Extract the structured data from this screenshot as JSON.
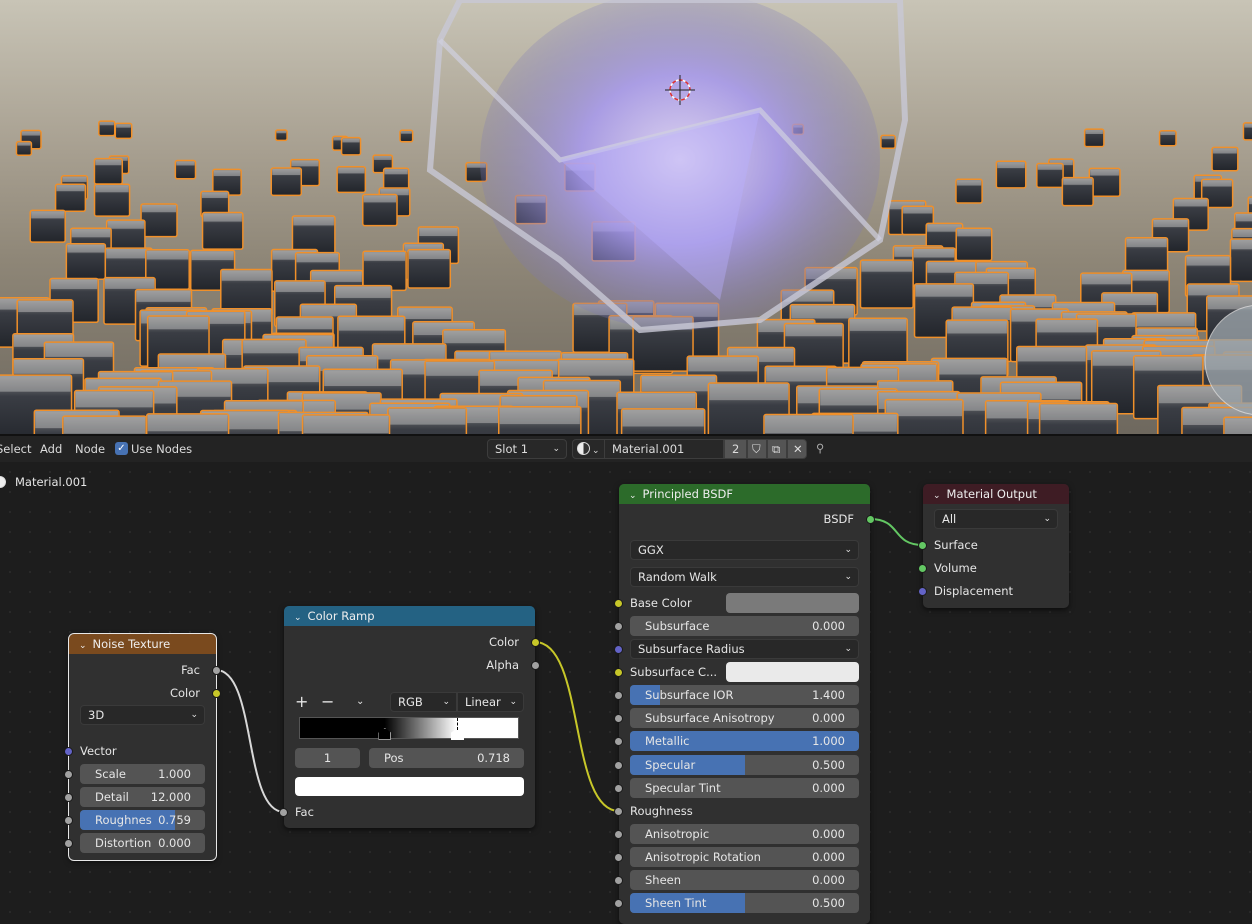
{
  "header": {
    "menus": [
      "Select",
      "Add",
      "Node"
    ],
    "use_nodes": {
      "label": "Use Nodes",
      "checked": true
    },
    "slot": "Slot 1",
    "material_name": "Material.001",
    "user_count": "2",
    "icons": [
      "material-ball-icon",
      "fake-user-shield-icon",
      "duplicate-icon",
      "close-icon",
      "pin-icon"
    ]
  },
  "breadcrumb": "Material.001",
  "colors": {
    "accent": "#4772b3",
    "selection_outline": "#f0902a",
    "socket_float": "#a1a1a1",
    "socket_color": "#c7c729",
    "socket_vector": "#6363c7",
    "socket_shader": "#63c763"
  },
  "nodes": {
    "principled": {
      "title": "Principled BSDF",
      "header_color": "#2c6b2a",
      "rows": [
        {
          "type": "output",
          "label": "BSDF",
          "socket": "shader"
        },
        {
          "type": "dropdown",
          "value": "GGX"
        },
        {
          "type": "dropdown",
          "value": "Random Walk"
        },
        {
          "type": "color",
          "label": "Base Color",
          "swatch": "#7a7a7a",
          "socket": "color"
        },
        {
          "type": "slider",
          "label": "Subsurface",
          "value": "0.000",
          "fill": 0,
          "socket": "float"
        },
        {
          "type": "dropdown",
          "value": "Subsurface Radius",
          "socket": "vector"
        },
        {
          "type": "color",
          "label": "Subsurface C...",
          "swatch": "#eaeaea",
          "socket": "color"
        },
        {
          "type": "slider",
          "label": "Subsurface IOR",
          "value": "1.400",
          "fill": 0.13,
          "socket": "float"
        },
        {
          "type": "slider",
          "label": "Subsurface Anisotropy",
          "value": "0.000",
          "fill": 0,
          "socket": "float"
        },
        {
          "type": "slider",
          "label": "Metallic",
          "value": "1.000",
          "fill": 1,
          "socket": "float"
        },
        {
          "type": "slider",
          "label": "Specular",
          "value": "0.500",
          "fill": 0.5,
          "socket": "float"
        },
        {
          "type": "slider",
          "label": "Specular Tint",
          "value": "0.000",
          "fill": 0,
          "socket": "float"
        },
        {
          "type": "input",
          "label": "Roughness",
          "socket": "float"
        },
        {
          "type": "slider",
          "label": "Anisotropic",
          "value": "0.000",
          "fill": 0,
          "socket": "float"
        },
        {
          "type": "slider",
          "label": "Anisotropic Rotation",
          "value": "0.000",
          "fill": 0,
          "socket": "float"
        },
        {
          "type": "slider",
          "label": "Sheen",
          "value": "0.000",
          "fill": 0,
          "socket": "float"
        },
        {
          "type": "slider",
          "label": "Sheen Tint",
          "value": "0.500",
          "fill": 0.5,
          "socket": "float"
        }
      ]
    },
    "output": {
      "title": "Material Output",
      "header_color": "#3e1c24",
      "rows": [
        {
          "type": "dropdown",
          "value": "All"
        },
        {
          "type": "input",
          "label": "Surface",
          "socket": "shader"
        },
        {
          "type": "input",
          "label": "Volume",
          "socket": "shader"
        },
        {
          "type": "input",
          "label": "Displacement",
          "socket": "vector"
        }
      ]
    },
    "noise": {
      "title": "Noise Texture",
      "header_color": "#7a4a1e",
      "rows": [
        {
          "type": "output",
          "label": "Fac",
          "socket": "float"
        },
        {
          "type": "output",
          "label": "Color",
          "socket": "color"
        },
        {
          "type": "dropdown",
          "value": "3D"
        },
        {
          "type": "input",
          "label": "Vector",
          "socket": "vector"
        },
        {
          "type": "slider",
          "label": "Scale",
          "value": "1.000",
          "fill": 0,
          "socket": "float"
        },
        {
          "type": "slider",
          "label": "Detail",
          "value": "12.000",
          "fill": 0,
          "socket": "float"
        },
        {
          "type": "slider",
          "label": "Roughnes",
          "value": "0.759",
          "fill": 0.759,
          "socket": "float"
        },
        {
          "type": "slider",
          "label": "Distortion",
          "value": "0.000",
          "fill": 0,
          "socket": "float"
        }
      ]
    },
    "colorramp": {
      "title": "Color Ramp",
      "header_color": "#246283",
      "outputs": [
        {
          "label": "Color",
          "socket": "color"
        },
        {
          "label": "Alpha",
          "socket": "float"
        }
      ],
      "add": "+",
      "remove": "−",
      "mode": "RGB",
      "interpolation": "Linear",
      "stops": [
        {
          "pos": 0.388,
          "color": "#000000"
        },
        {
          "pos": 0.718,
          "color": "#ffffff"
        }
      ],
      "active_index": "1",
      "pos_label": "Pos",
      "pos_value": "0.718",
      "active_color": "#ffffff",
      "input": {
        "label": "Fac",
        "socket": "float"
      }
    }
  }
}
